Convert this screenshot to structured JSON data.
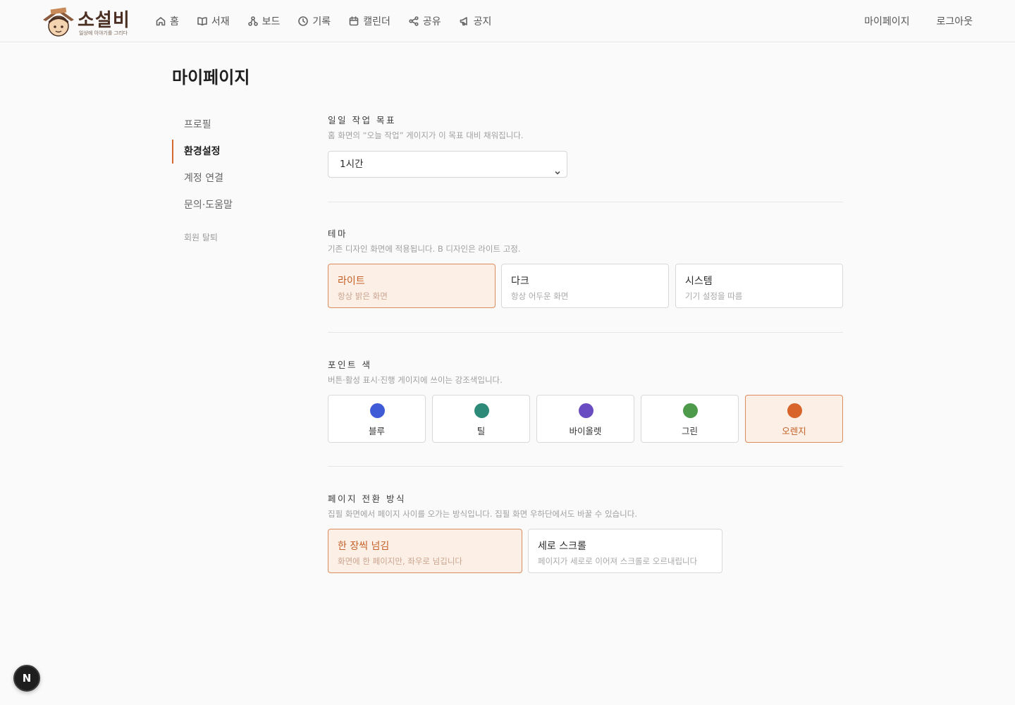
{
  "header": {
    "brand": "소설비",
    "tagline": "일상에 이야기를 그리다",
    "nav": [
      {
        "label": "홈",
        "icon": "home-icon"
      },
      {
        "label": "서재",
        "icon": "book-icon"
      },
      {
        "label": "보드",
        "icon": "board-icon"
      },
      {
        "label": "기록",
        "icon": "clock-icon"
      },
      {
        "label": "캘린더",
        "icon": "calendar-icon"
      },
      {
        "label": "공유",
        "icon": "share-icon"
      },
      {
        "label": "공지",
        "icon": "megaphone-icon"
      }
    ],
    "mypage": "마이페이지",
    "logout": "로그아웃"
  },
  "page": {
    "title": "마이페이지"
  },
  "sidebar": {
    "items": [
      {
        "label": "프로필",
        "active": false
      },
      {
        "label": "환경설정",
        "active": true
      },
      {
        "label": "계정 연결",
        "active": false
      },
      {
        "label": "문의·도움말",
        "active": false
      }
    ],
    "withdraw": "회원 탈퇴"
  },
  "settings": {
    "goal": {
      "title": "일일 작업 목표",
      "desc": "홈 화면의 “오늘 작업” 게이지가 이 목표 대비 채워집니다.",
      "value": "1시간"
    },
    "theme": {
      "title": "테마",
      "desc": "기존 디자인 화면에 적용됩니다. B 디자인은 라이트 고정.",
      "options": [
        {
          "title": "라이트",
          "desc": "항상 밝은 화면",
          "selected": true
        },
        {
          "title": "다크",
          "desc": "항상 어두운 화면",
          "selected": false
        },
        {
          "title": "시스템",
          "desc": "기기 설정을 따름",
          "selected": false
        }
      ]
    },
    "accent": {
      "title": "포인트 색",
      "desc": "버튼·활성 표시·진행 게이지에 쓰이는 강조색입니다.",
      "options": [
        {
          "label": "블루",
          "color": "#3f5bd6",
          "selected": false
        },
        {
          "label": "틸",
          "color": "#2e8a78",
          "selected": false
        },
        {
          "label": "바이올렛",
          "color": "#6a4cc2",
          "selected": false
        },
        {
          "label": "그린",
          "color": "#4c9a4a",
          "selected": false
        },
        {
          "label": "오렌지",
          "color": "#d8642b",
          "selected": true
        }
      ]
    },
    "transition": {
      "title": "페이지 전환 방식",
      "desc": "집필 화면에서 페이지 사이를 오가는 방식입니다. 집필 화면 우하단에서도 바꿀 수 있습니다.",
      "options": [
        {
          "title": "한 장씩 넘김",
          "desc": "화면에 한 페이지만, 좌우로 넘깁니다",
          "selected": true
        },
        {
          "title": "세로 스크롤",
          "desc": "페이지가 세로로 이어져 스크롤로 오르내립니다",
          "selected": false
        }
      ]
    }
  },
  "fab": {
    "label": "N"
  }
}
